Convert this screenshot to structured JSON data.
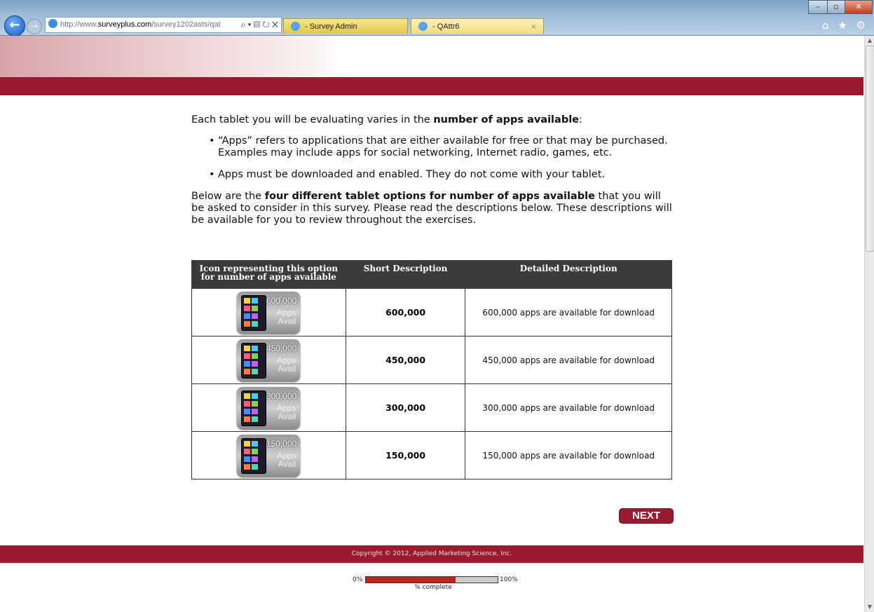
{
  "browser": {
    "url_prefix": "http://www.",
    "url_domain": "surveyplus.com",
    "url_path": "/survey1202asts/qat",
    "url_tools": "⌕ ▾ ▤ ↻ ✕",
    "tabs": [
      {
        "label": "- Survey Admin"
      },
      {
        "label": "- QAttr6",
        "close": "×"
      }
    ],
    "window_controls": {
      "minimize": "–",
      "maximize": "▫",
      "close": "✕"
    },
    "toolbar_icons": "⌂ ★ ⚙",
    "back_icon": "←",
    "forward_icon": "→"
  },
  "intro": {
    "prefix": "Each tablet you will be evaluating varies in the ",
    "bold": "number of apps available",
    "suffix": ":"
  },
  "bullets": [
    "“Apps” refers to applications that are either available for free or that may be purchased. Examples may include apps for social networking, Internet radio, games, etc.",
    "Apps must be downloaded and enabled. They do not come with your tablet."
  ],
  "below": {
    "prefix": "Below are the ",
    "bold": "four different tablet options for number of apps available",
    "suffix": " that you will be asked to consider in this survey. Please read the descriptions below. These descriptions will be available for you to review throughout the exercises."
  },
  "table": {
    "headers": [
      "Icon representing this option for number of apps available",
      "Short Description",
      "Detailed Description"
    ],
    "rows": [
      {
        "icon_count": "600,000",
        "icon_apps": "Apps",
        "icon_avail": "Avail",
        "short": "600,000",
        "detail": "600,000 apps are available for download"
      },
      {
        "icon_count": "450,000",
        "icon_apps": "Apps",
        "icon_avail": "Avail",
        "short": "450,000",
        "detail": "450,000 apps are available for download"
      },
      {
        "icon_count": "300,000",
        "icon_apps": "Apps",
        "icon_avail": "Avail",
        "short": "300,000",
        "detail": "300,000 apps are available for download"
      },
      {
        "icon_count": "150,000",
        "icon_apps": "Apps",
        "icon_avail": "Avail",
        "short": "150,000",
        "detail": "150,000 apps are available for download"
      }
    ]
  },
  "next_label": "NEXT",
  "footer": {
    "copyright": "Copyright © 2012, Applied Marketing Science, Inc."
  },
  "progress": {
    "min_label": "0%",
    "max_label": "100%",
    "label": "% complete",
    "value": 0.68
  },
  "colors": {
    "brand": "#9a1b2f",
    "progress_fill": "#c81f1f",
    "header_bg": "#3b3b3b"
  }
}
